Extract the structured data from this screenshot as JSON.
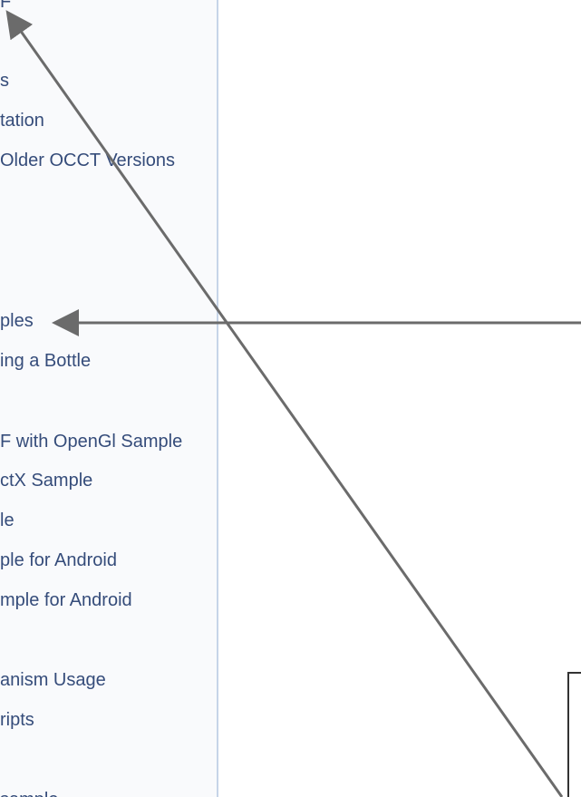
{
  "sidebar": {
    "items": [
      {
        "label": "F"
      },
      {
        "label": "s"
      },
      {
        "label": "tation"
      },
      {
        "label": "Older OCCT Versions"
      },
      {
        "label": "ples"
      },
      {
        "label": "ing a Bottle"
      },
      {
        "label": "F with OpenGl Sample"
      },
      {
        "label": "ctX Sample"
      },
      {
        "label": "le"
      },
      {
        "label": "ple for Android"
      },
      {
        "label": "mple for Android"
      },
      {
        "label": "anism Usage"
      },
      {
        "label": "ripts"
      },
      {
        "label": "sample"
      }
    ]
  },
  "annotation_color": "#6b6b6b"
}
